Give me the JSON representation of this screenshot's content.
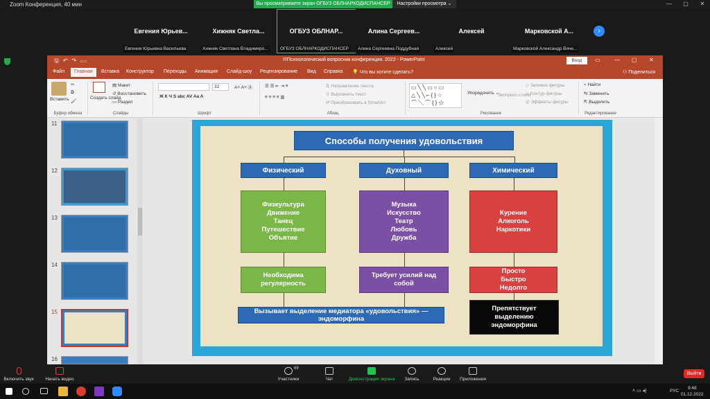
{
  "zoom": {
    "window_title": "Zoom Конференция, 40 мин",
    "share_banner": "Вы просматриваете экран ОГБУЗ ОБЛНАРКОДИСПАНСЕР",
    "view_options": "Настройки просмотра",
    "participants": [
      {
        "name": "Евгения Юрьев...",
        "label": "Евгения Юрьевна Васильева"
      },
      {
        "name": "Хижняк Светла...",
        "label": "Хижняк Светлана Владимиро..."
      },
      {
        "name": "ОГБУЗ ОБЛНАР...",
        "label": "ОГБУЗ ОБЛНАРКОДИСПАНСЕР"
      },
      {
        "name": "Алина Сергеев...",
        "label": "Алина Сергеевна Поддубная"
      },
      {
        "name": "Алексей",
        "label": "Алексей"
      },
      {
        "name": "Марковской А...",
        "label": "Марковской Александр Вяче..."
      }
    ],
    "toolbar": {
      "mute": "Включить звук",
      "video": "Начать видео",
      "participants": "Участники",
      "participants_count": "69",
      "chat": "Чат",
      "share": "Демонстрация экрана",
      "record": "Запись",
      "reactions": "Реакции",
      "apps": "Приложения",
      "leave": "Выйти"
    }
  },
  "ppt": {
    "title": "!!!Психологический вопросник конференция. 2022 - PowerPoint",
    "login": "Вход",
    "share": "Поделиться",
    "tabs": [
      "Файл",
      "Главная",
      "Вставка",
      "Конструктор",
      "Переходы",
      "Анимация",
      "Слайд-шоу",
      "Рецензирование",
      "Вид",
      "Справка",
      "Что вы хотите сделать?"
    ],
    "ribbon": {
      "paste": "Вставить",
      "clipboard": "Буфер обмена",
      "new_slide": "Создать слайд",
      "layout": "Макет",
      "reset": "Восстановить",
      "section": "Раздел",
      "slides": "Слайды",
      "font_size": "32",
      "font_group": "Шрифт",
      "text_direction": "Направление текста",
      "align_text": "Выровнять текст",
      "smartart": "Преобразовать в SmartArt",
      "paragraph": "Абзац",
      "arrange": "Упорядочить",
      "quick_styles": "Экспресс-стили",
      "shape_fill": "Заливка фигуры",
      "shape_outline": "Контур фигуры",
      "shape_effects": "Эффекты фигуры",
      "drawing": "Рисование",
      "find": "Найти",
      "replace": "Заменить",
      "select": "Выделить",
      "editing": "Редактирование"
    },
    "thumb_numbers": [
      "11",
      "12",
      "13",
      "14",
      "15",
      "16"
    ]
  },
  "slide": {
    "title": "Способы получения удовольствия",
    "col1_header": "Физический",
    "col2_header": "Духовный",
    "col3_header": "Химический",
    "col1_items": [
      "Физкультура",
      "Движение",
      "Танец",
      "Путешествие",
      "Объятие"
    ],
    "col2_items": [
      "Музыка",
      "Искусство",
      "Театр",
      "Любовь",
      "Дружба"
    ],
    "col3_items": [
      "Курение",
      "Алкоголь",
      "Наркотики"
    ],
    "col1_note": "Необходима регулярность",
    "col2_note": "Требует усилий над собой",
    "col3_note": [
      "Просто",
      "Быстро",
      "Недолго"
    ],
    "bottom_blue": "Вызывает выделение медиатора «удовольствия» — эндоморфина",
    "bottom_black": "Препятствует выделению эндоморфина"
  },
  "system": {
    "time": "9:48",
    "date": "01.12.2022",
    "lang": "РУС"
  }
}
